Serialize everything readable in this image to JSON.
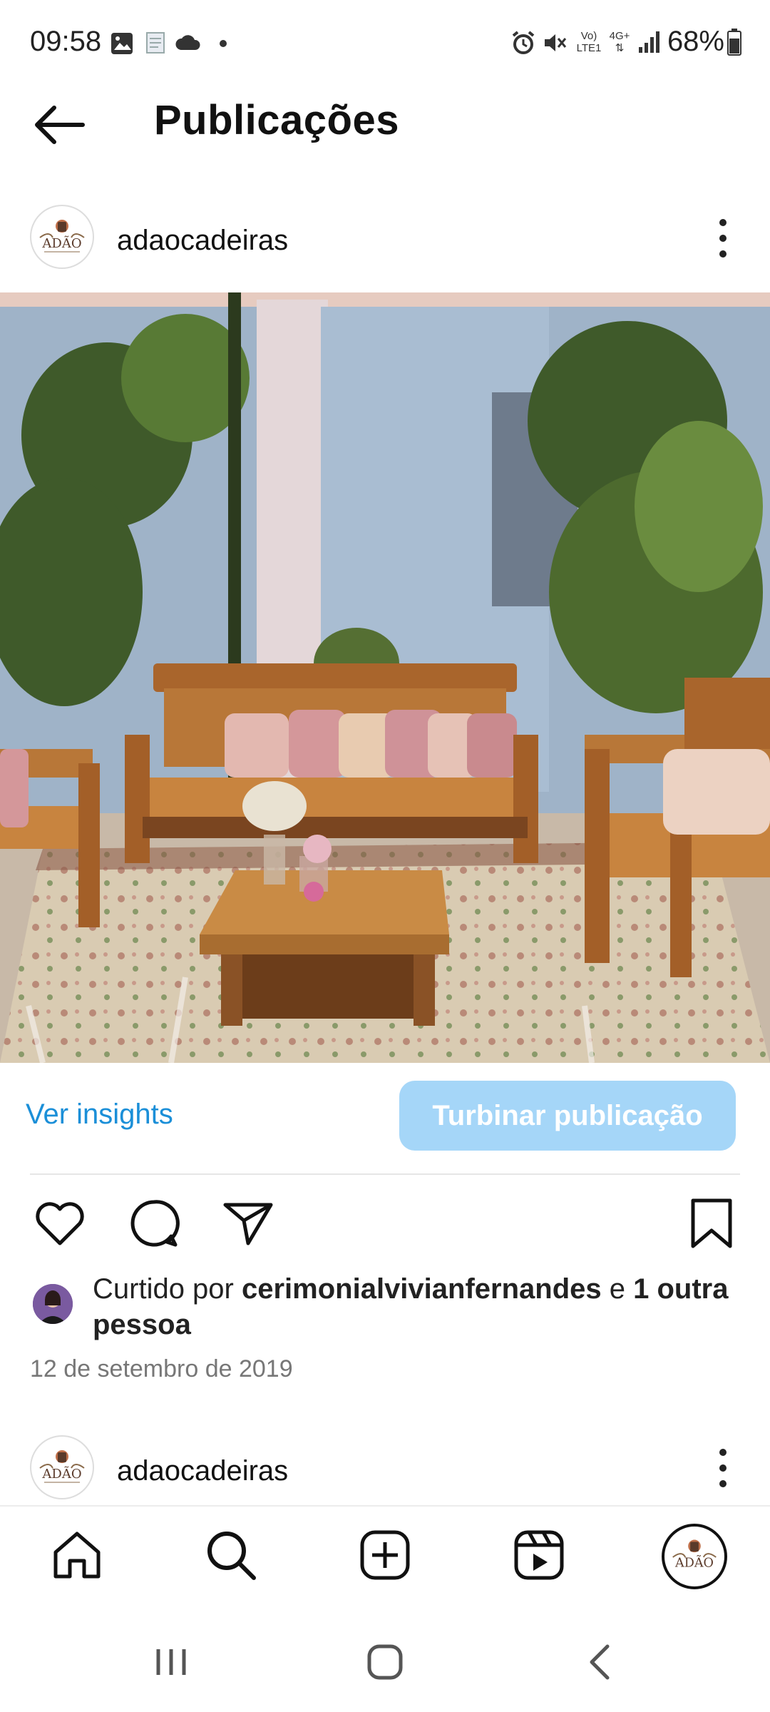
{
  "status_bar": {
    "time": "09:58",
    "battery": "68%",
    "network_label_1": "Vo)",
    "network_label_2": "LTE1",
    "network_label_3": "4G+"
  },
  "header": {
    "title": "Publicações"
  },
  "post": {
    "username": "adaocadeiras",
    "avatar_logo_text": "ADÃO",
    "insights_label": "Ver insights",
    "boost_label": "Turbinar publicação",
    "likes_prefix": "Curtido por ",
    "likes_user": "cerimonialvivianfernandes",
    "likes_mid": " e ",
    "likes_others": "1 outra pessoa",
    "date": "12 de setembro de 2019"
  },
  "next_post": {
    "username": "adaocadeiras"
  },
  "colors": {
    "accent_link": "#1b8fd8",
    "boost_button": "#a5d6f8"
  },
  "icons": {
    "back": "arrow-left-icon",
    "more": "more-vertical-icon",
    "like": "heart-icon",
    "comment": "comment-icon",
    "share": "send-icon",
    "save": "bookmark-icon",
    "home": "home-icon",
    "search": "search-icon",
    "create": "plus-square-icon",
    "reels": "reels-icon",
    "profile": "profile-avatar-icon"
  }
}
